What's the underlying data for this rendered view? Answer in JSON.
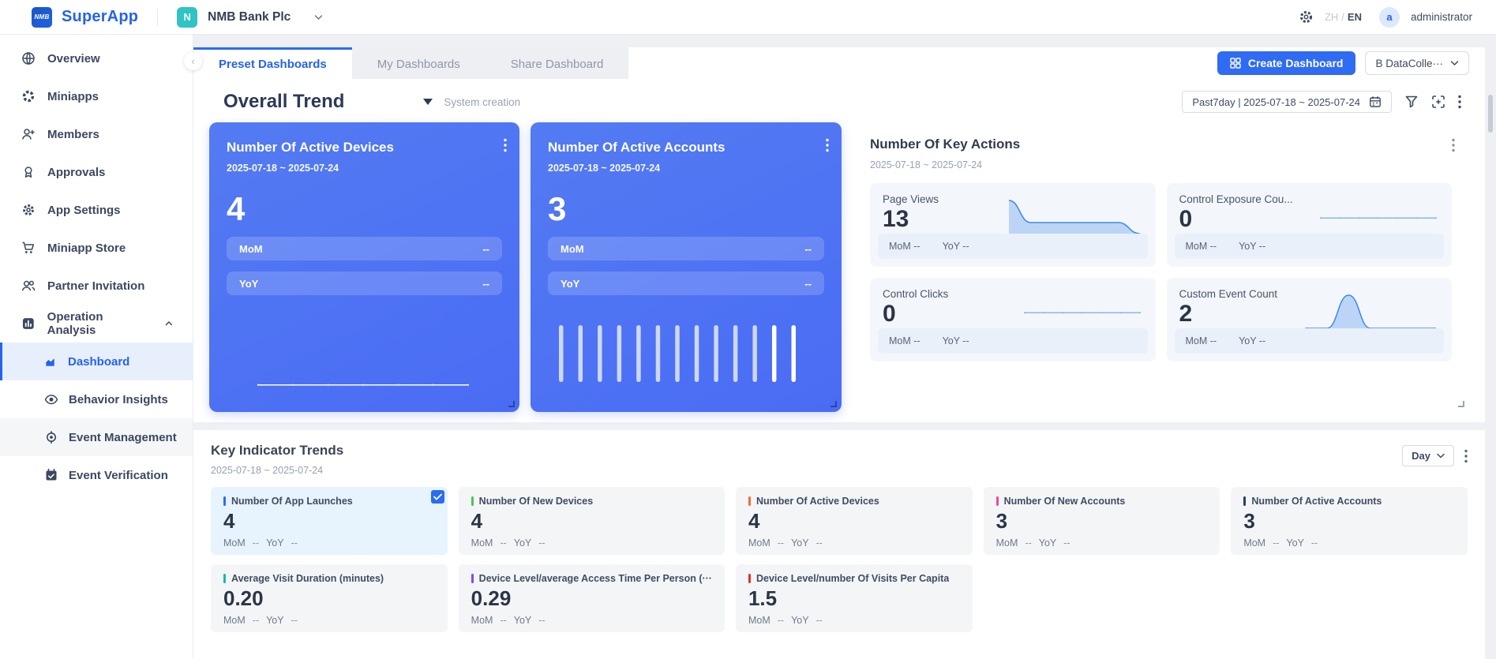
{
  "topbar": {
    "logo_text": "NMB",
    "app_name": "SuperApp",
    "tenant_initial": "N",
    "tenant_name": "NMB Bank Plc",
    "lang_zh": "ZH",
    "lang_divider": "/",
    "lang_en": "EN",
    "user_initial": "a",
    "user_name": "administrator"
  },
  "sidebar": {
    "collapse_glyph": "‹",
    "items": [
      {
        "label": "Overview"
      },
      {
        "label": "Miniapps"
      },
      {
        "label": "Members"
      },
      {
        "label": "Approvals"
      },
      {
        "label": "App Settings"
      },
      {
        "label": "Miniapp Store"
      },
      {
        "label": "Partner Invitation"
      },
      {
        "label": "Operation Analysis",
        "expanded": true
      }
    ],
    "sub_items": [
      {
        "label": "Dashboard",
        "active": true
      },
      {
        "label": "Behavior Insights",
        "active": false
      },
      {
        "label": "Event Management",
        "active": false
      },
      {
        "label": "Event Verification",
        "active": false
      }
    ]
  },
  "tabs": {
    "preset": "Preset Dashboards",
    "my": "My Dashboards",
    "share": "Share Dashboard"
  },
  "actions": {
    "create_dashboard": "Create Dashboard",
    "data_collection": "B DataColle···"
  },
  "trend": {
    "title": "Overall Trend",
    "creator": "System creation",
    "date_range_pill": "Past7day | 2025-07-18 ~ 2025-07-24"
  },
  "cards": {
    "active_devices": {
      "title": "Number Of Active Devices",
      "date": "2025-07-18 ~ 2025-07-24",
      "value": "4",
      "mom_label": "MoM",
      "mom_value": "--",
      "yoy_label": "YoY",
      "yoy_value": "--",
      "spark": [
        4,
        4,
        4,
        4,
        4,
        4,
        4
      ]
    },
    "active_accounts": {
      "title": "Number Of Active Accounts",
      "date": "2025-07-18 ~ 2025-07-24",
      "value": "3",
      "mom_label": "MoM",
      "mom_value": "--",
      "yoy_label": "YoY",
      "yoy_value": "--",
      "bars": [
        1,
        1,
        1,
        1,
        1,
        1,
        1,
        1,
        1,
        1,
        1,
        1,
        1
      ]
    },
    "key_actions": {
      "title": "Number Of Key Actions",
      "date": "2025-07-18 ~ 2025-07-24",
      "tiles": [
        {
          "label": "Page Views",
          "value": "13",
          "mom": "MoM --",
          "yoy": "YoY --",
          "spark": [
            6,
            2,
            2,
            2,
            2,
            2,
            0
          ],
          "type": "area"
        },
        {
          "label": "Control Exposure Cou...",
          "value": "0",
          "mom": "MoM --",
          "yoy": "YoY --",
          "spark": [
            0,
            0,
            0,
            0,
            0,
            0,
            0
          ],
          "type": "line"
        },
        {
          "label": "Control Clicks",
          "value": "0",
          "mom": "MoM --",
          "yoy": "YoY --",
          "spark": [
            0,
            0,
            0,
            0,
            0,
            0,
            0
          ],
          "type": "line"
        },
        {
          "label": "Custom Event Count",
          "value": "2",
          "mom": "MoM --",
          "yoy": "YoY --",
          "spark": [
            0,
            0,
            2,
            0,
            0,
            0,
            0
          ],
          "type": "area"
        }
      ]
    }
  },
  "key_indicators": {
    "title": "Key Indicator Trends",
    "date": "2025-07-18 ~ 2025-07-24",
    "granularity": "Day",
    "mom_label": "MoM",
    "yoy_label": "YoY",
    "dash": "--",
    "cards": [
      {
        "label": "Number Of App Launches",
        "value": "4",
        "color": "#2b6cf0",
        "selected": true
      },
      {
        "label": "Number Of New Devices",
        "value": "4",
        "color": "#4fc24c",
        "selected": false
      },
      {
        "label": "Number Of Active Devices",
        "value": "4",
        "color": "#f5683c",
        "selected": false
      },
      {
        "label": "Number Of New Accounts",
        "value": "3",
        "color": "#ea4c9c",
        "selected": false
      },
      {
        "label": "Number Of Active Accounts",
        "value": "3",
        "color": "#2c3e66",
        "selected": false
      },
      {
        "label": "Average Visit Duration (minutes)",
        "value": "0.20",
        "color": "#14b8b4",
        "selected": false
      },
      {
        "label": "Device Level/average Access Time Per Person (···",
        "value": "0.29",
        "color": "#7c4bed",
        "selected": false
      },
      {
        "label": "Device Level/number Of Visits Per Capita",
        "value": "1.5",
        "color": "#e5312e",
        "selected": false
      }
    ]
  }
}
